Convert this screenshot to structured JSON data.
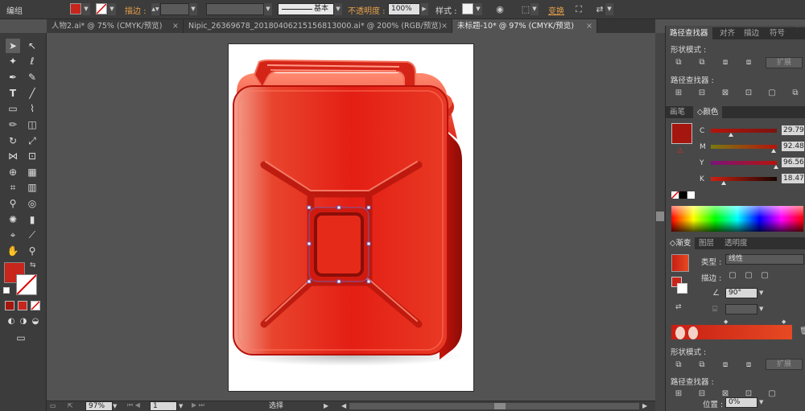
{
  "control_bar": {
    "object_label": "编组",
    "stroke_label": "描边 :",
    "stroke_weight": "",
    "profile_label": "基本",
    "opacity_label": "不透明度 :",
    "opacity_value": "100%",
    "style_label": "样式 :",
    "transform_label": "变换",
    "colors": {
      "fill": "#c8251c"
    }
  },
  "tabs": [
    {
      "label": "人物2.ai* @ 75% (CMYK/预览)"
    },
    {
      "label": "Nipic_26369678_20180406215156813000.ai* @ 200% (RGB/预览)"
    },
    {
      "label": "未标题-10* @ 97% (CMYK/预览)"
    }
  ],
  "tab_close": "×",
  "status_bar": {
    "zoom": "97%",
    "page": "1",
    "tool_name": "选择"
  },
  "pathfinder_panel": {
    "tabs": [
      "路径查找器",
      "对齐",
      "描边",
      "符号"
    ],
    "shape_modes_label": "形状模式 :",
    "pathfinders_label": "路径查找器 :",
    "expand_label": "扩展"
  },
  "color_panel": {
    "tabs": [
      "画笔",
      "颜色"
    ],
    "fill_color": "#a5160f",
    "channels": [
      {
        "name": "C",
        "value": "29.79"
      },
      {
        "name": "M",
        "value": "92.48"
      },
      {
        "name": "Y",
        "value": "96.56"
      },
      {
        "name": "K",
        "value": "18.47"
      }
    ]
  },
  "gradient_panel": {
    "tabs": [
      "渐变",
      "图层",
      "透明度"
    ],
    "type_label": "类型 :",
    "type_value": "线性",
    "stroke_label": "描边 :",
    "angle_value": "90°",
    "gradient_from": "#c81e14",
    "gradient_to": "#e64a22"
  },
  "bottom_panel": {
    "shape_modes_label": "形状模式 :",
    "expand_label": "扩展",
    "pathfinders_label": "路径查找器 :",
    "position_label": "位置 :",
    "position_value": "0%"
  }
}
